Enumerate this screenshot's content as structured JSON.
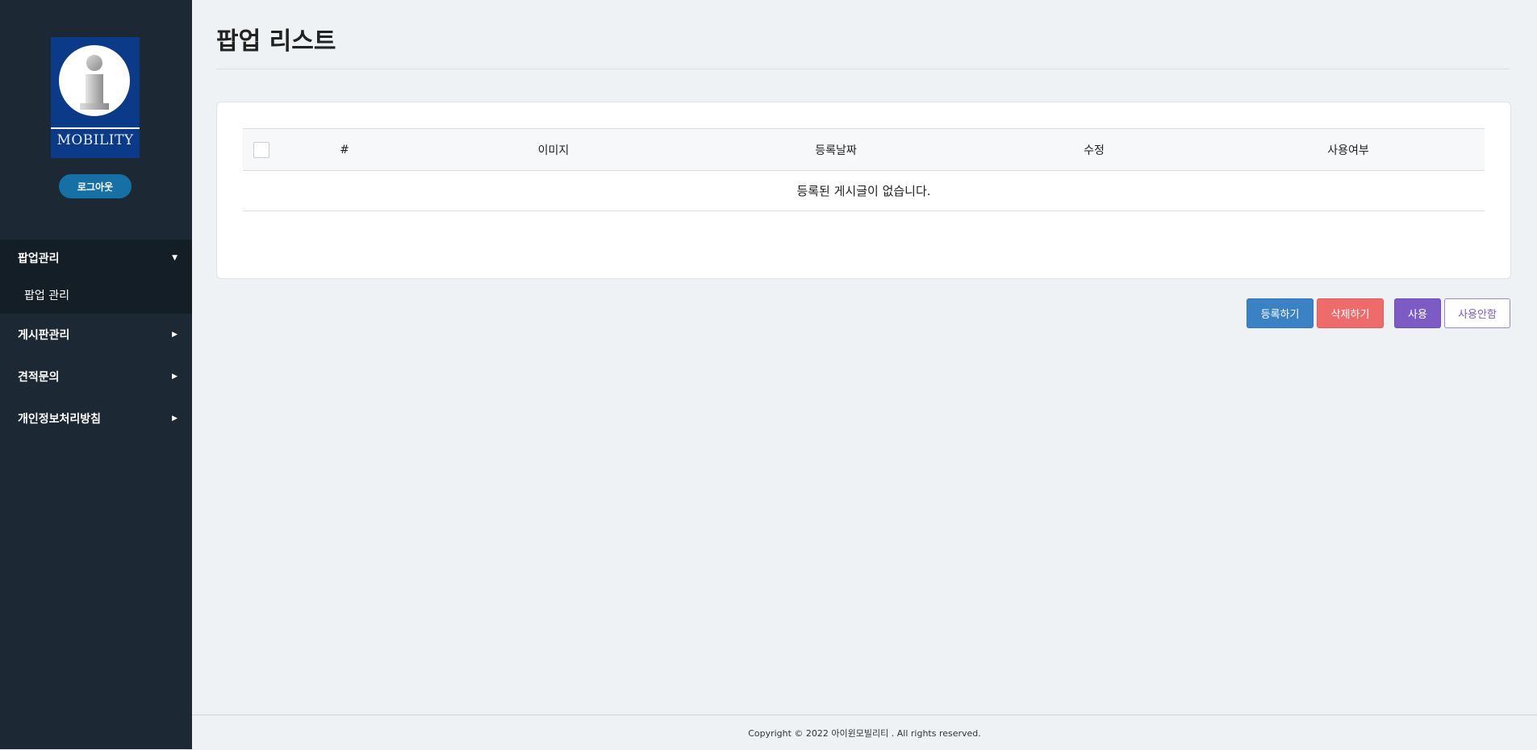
{
  "sidebar": {
    "logo_text": "MOBILITY",
    "logout_label": "로그아웃",
    "nav": [
      {
        "label": "팝업관리",
        "expanded": true,
        "arrow": "▼",
        "sub": [
          {
            "label": "팝업 관리"
          }
        ]
      },
      {
        "label": "게시판관리",
        "expanded": false,
        "arrow": "▶"
      },
      {
        "label": "견적문의",
        "expanded": false,
        "arrow": "▶"
      },
      {
        "label": "개인정보처리방침",
        "expanded": false,
        "arrow": "▶"
      }
    ]
  },
  "main": {
    "title": "팝업 리스트",
    "table": {
      "columns": [
        "#",
        "이미지",
        "등록날짜",
        "수정",
        "사용여부"
      ],
      "empty_message": "등록된 게시글이 없습니다."
    },
    "actions": {
      "register": "등록하기",
      "delete": "삭제하기",
      "use": "사용",
      "unuse": "사용안함"
    }
  },
  "footer": {
    "copyright": "Copyright © 2022 아이윈모빌리티 . All rights reserved."
  },
  "colors": {
    "sidebar_bg": "#1c2833",
    "logout": "#1670a6",
    "register": "#3b82c4",
    "delete": "#ee6b6b",
    "use": "#7c5cc4"
  }
}
